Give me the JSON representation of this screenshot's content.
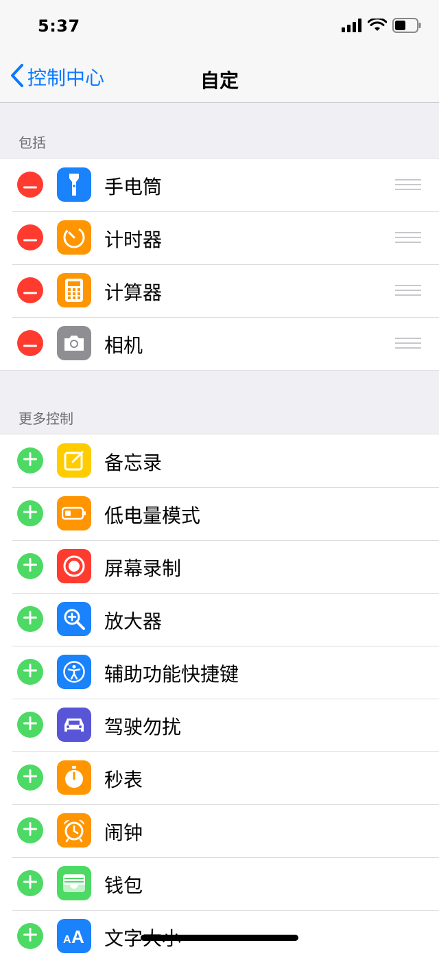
{
  "status": {
    "time": "5:37",
    "battery_level": 0.5
  },
  "nav": {
    "back_label": "控制中心",
    "title": "自定"
  },
  "included": {
    "header": "包括",
    "items": [
      {
        "label": "手电筒",
        "icon": "flashlight-icon",
        "color": "#1a82fb"
      },
      {
        "label": "计时器",
        "icon": "timer-icon",
        "color": "#ff9500"
      },
      {
        "label": "计算器",
        "icon": "calculator-icon",
        "color": "#ff9500"
      },
      {
        "label": "相机",
        "icon": "camera-icon",
        "color": "#8e8e93"
      }
    ]
  },
  "more": {
    "header": "更多控制",
    "items": [
      {
        "label": "备忘录",
        "icon": "notes-icon",
        "color": "#ffcc00"
      },
      {
        "label": "低电量模式",
        "icon": "low-power-icon",
        "color": "#ff9500"
      },
      {
        "label": "屏幕录制",
        "icon": "screen-record-icon",
        "color": "#ff3b30"
      },
      {
        "label": "放大器",
        "icon": "magnifier-icon",
        "color": "#1a82fb"
      },
      {
        "label": "辅助功能快捷键",
        "icon": "accessibility-icon",
        "color": "#1a82fb"
      },
      {
        "label": "驾驶勿扰",
        "icon": "car-icon",
        "color": "#5856d6"
      },
      {
        "label": "秒表",
        "icon": "stopwatch-icon",
        "color": "#ff9500"
      },
      {
        "label": "闹钟",
        "icon": "alarm-icon",
        "color": "#ff9500"
      },
      {
        "label": "钱包",
        "icon": "wallet-icon",
        "color": "#4cd964"
      },
      {
        "label": "文字大小",
        "icon": "text-size-icon",
        "color": "#1a82fb"
      }
    ]
  },
  "colors": {
    "accent": "#0a7aff",
    "remove": "#ff3b30",
    "add": "#4cd964"
  }
}
